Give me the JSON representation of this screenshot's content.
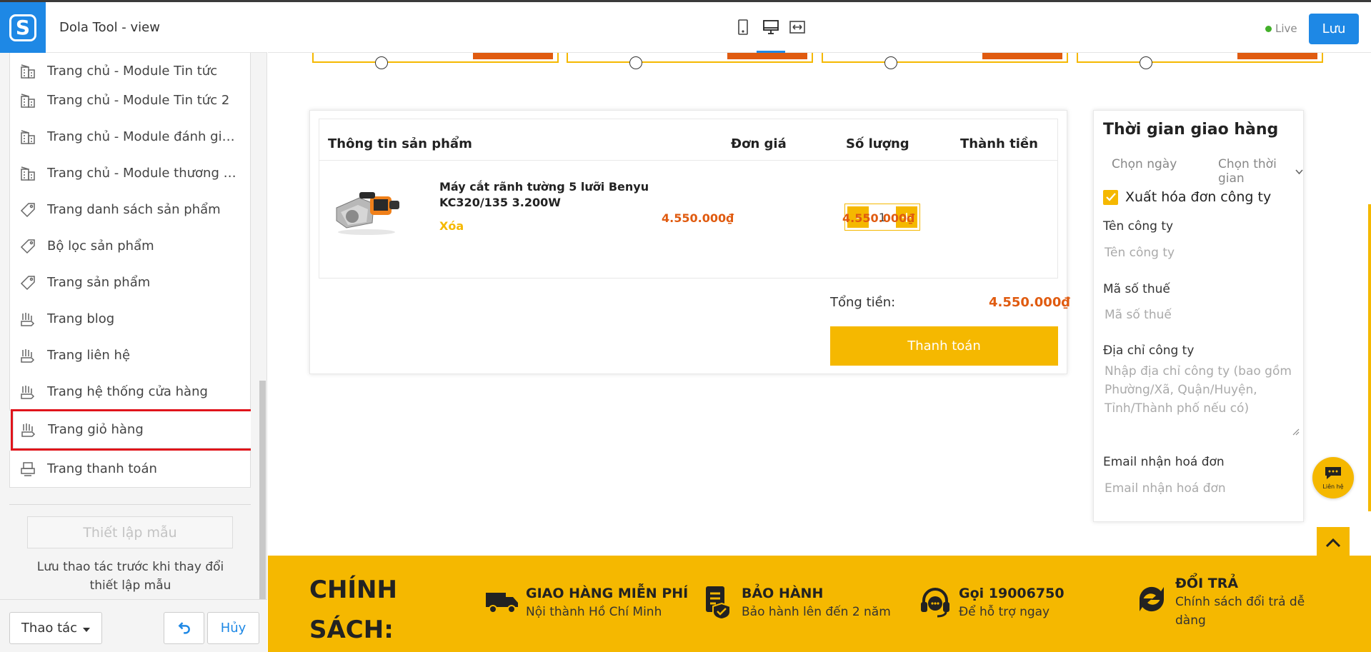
{
  "app": {
    "title": "Dola Tool - view",
    "logo_letter": "S"
  },
  "sidebar": {
    "items": [
      {
        "label": "Trang chủ - Module Tin tức",
        "icon": "building-icon"
      },
      {
        "label": "Trang chủ - Module Tin tức 2",
        "icon": "building-icon"
      },
      {
        "label": "Trang chủ - Module đánh giá kh...",
        "icon": "building-icon"
      },
      {
        "label": "Trang chủ - Module thương hiệu",
        "icon": "building-icon"
      },
      {
        "label": "Trang danh sách sản phẩm",
        "icon": "tag-icon"
      },
      {
        "label": "Bộ lọc sản phẩm",
        "icon": "tag-icon"
      },
      {
        "label": "Trang sản phẩm",
        "icon": "tag-icon"
      },
      {
        "label": "Trang blog",
        "icon": "hand-icon"
      },
      {
        "label": "Trang liên hệ",
        "icon": "hand-icon"
      },
      {
        "label": "Trang hệ thống cửa hàng",
        "icon": "hand-icon"
      },
      {
        "label": "Trang giỏ hàng",
        "icon": "hand-icon",
        "selected": true
      },
      {
        "label": "Trang thanh toán",
        "icon": "printer-icon"
      }
    ],
    "template_button": "Thiết lập mẫu",
    "template_note": "Lưu thao tác trước khi thay đổi thiết lập mẫu",
    "actions_label": "Thao tác",
    "cancel_label": "Hủy"
  },
  "topbar": {
    "devices": [
      "mobile-icon",
      "desktop-icon",
      "fullwidth-icon"
    ],
    "active_device": "desktop-icon",
    "live_label": "Live",
    "save_label": "Lưu"
  },
  "cart": {
    "headers": {
      "product": "Thông tin sản phẩm",
      "price": "Đơn giá",
      "quantity": "Số lượng",
      "total": "Thành tiền"
    },
    "item": {
      "name": "Máy cắt rãnh tường 5 lưỡi Benyu KC320/135 3.200W",
      "remove": "Xóa",
      "price": "4.550.000₫",
      "quantity": "1",
      "line_total": "4.550.000₫",
      "minus": "-",
      "plus": "+"
    },
    "total_label": "Tổng tiền:",
    "total_value": "4.550.000₫",
    "checkout": "Thanh toán"
  },
  "delivery": {
    "title": "Thời gian giao hàng",
    "date_placeholder": "Chọn ngày",
    "time_placeholder": "Chọn thời gian",
    "invoice_checkbox": "Xuất hóa đơn công ty",
    "company_label": "Tên công ty",
    "company_placeholder": "Tên công ty",
    "tax_label": "Mã số thuế",
    "tax_placeholder": "Mã số thuế",
    "address_label": "Địa chỉ công ty",
    "address_placeholder": "Nhập địa chỉ công ty (bao gồm Phường/Xã, Quận/Huyện, Tỉnh/Thành phố nếu có)",
    "email_label": "Email nhận hoá đơn",
    "email_placeholder": "Email nhận hoá đơn"
  },
  "floating": {
    "contact_label": "Liên hệ"
  },
  "policy": {
    "title_line1": "CHÍNH",
    "title_line2": "SÁCH:",
    "items": [
      {
        "title": "GIAO HÀNG MIỄN PHÍ",
        "sub": "Nội thành Hồ Chí Minh",
        "icon": "truck-icon"
      },
      {
        "title": "BẢO HÀNH",
        "sub": "Bảo hành lên đến 2 năm",
        "icon": "warranty-icon"
      },
      {
        "title": "Gọi 19006750",
        "sub": "Để hỗ trợ ngay",
        "icon": "headset-icon"
      },
      {
        "title": "ĐỔI TRẢ",
        "sub": "Chính sách đổi trả dễ dàng",
        "icon": "exchange-icon"
      }
    ]
  },
  "colors": {
    "accent": "#f5b800",
    "price": "#e05b10",
    "primary": "#1e88e5",
    "highlight": "#e0141b"
  }
}
